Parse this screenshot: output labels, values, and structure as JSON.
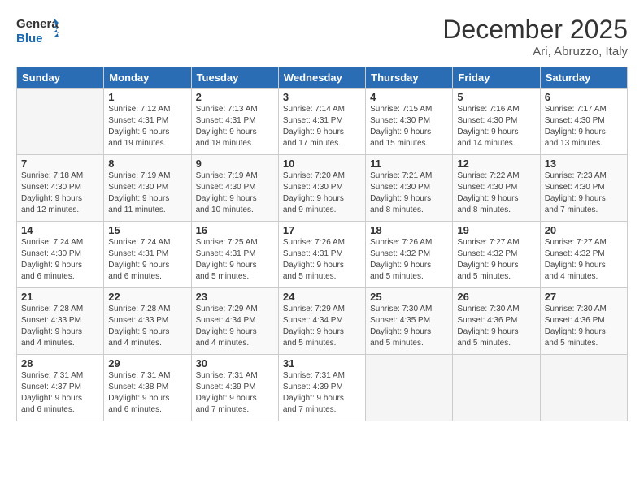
{
  "header": {
    "logo_line1": "General",
    "logo_line2": "Blue",
    "month": "December 2025",
    "location": "Ari, Abruzzo, Italy"
  },
  "weekdays": [
    "Sunday",
    "Monday",
    "Tuesday",
    "Wednesday",
    "Thursday",
    "Friday",
    "Saturday"
  ],
  "weeks": [
    [
      {
        "day": "",
        "info": ""
      },
      {
        "day": "1",
        "info": "Sunrise: 7:12 AM\nSunset: 4:31 PM\nDaylight: 9 hours\nand 19 minutes."
      },
      {
        "day": "2",
        "info": "Sunrise: 7:13 AM\nSunset: 4:31 PM\nDaylight: 9 hours\nand 18 minutes."
      },
      {
        "day": "3",
        "info": "Sunrise: 7:14 AM\nSunset: 4:31 PM\nDaylight: 9 hours\nand 17 minutes."
      },
      {
        "day": "4",
        "info": "Sunrise: 7:15 AM\nSunset: 4:30 PM\nDaylight: 9 hours\nand 15 minutes."
      },
      {
        "day": "5",
        "info": "Sunrise: 7:16 AM\nSunset: 4:30 PM\nDaylight: 9 hours\nand 14 minutes."
      },
      {
        "day": "6",
        "info": "Sunrise: 7:17 AM\nSunset: 4:30 PM\nDaylight: 9 hours\nand 13 minutes."
      }
    ],
    [
      {
        "day": "7",
        "info": "Sunrise: 7:18 AM\nSunset: 4:30 PM\nDaylight: 9 hours\nand 12 minutes."
      },
      {
        "day": "8",
        "info": "Sunrise: 7:19 AM\nSunset: 4:30 PM\nDaylight: 9 hours\nand 11 minutes."
      },
      {
        "day": "9",
        "info": "Sunrise: 7:19 AM\nSunset: 4:30 PM\nDaylight: 9 hours\nand 10 minutes."
      },
      {
        "day": "10",
        "info": "Sunrise: 7:20 AM\nSunset: 4:30 PM\nDaylight: 9 hours\nand 9 minutes."
      },
      {
        "day": "11",
        "info": "Sunrise: 7:21 AM\nSunset: 4:30 PM\nDaylight: 9 hours\nand 8 minutes."
      },
      {
        "day": "12",
        "info": "Sunrise: 7:22 AM\nSunset: 4:30 PM\nDaylight: 9 hours\nand 8 minutes."
      },
      {
        "day": "13",
        "info": "Sunrise: 7:23 AM\nSunset: 4:30 PM\nDaylight: 9 hours\nand 7 minutes."
      }
    ],
    [
      {
        "day": "14",
        "info": "Sunrise: 7:24 AM\nSunset: 4:30 PM\nDaylight: 9 hours\nand 6 minutes."
      },
      {
        "day": "15",
        "info": "Sunrise: 7:24 AM\nSunset: 4:31 PM\nDaylight: 9 hours\nand 6 minutes."
      },
      {
        "day": "16",
        "info": "Sunrise: 7:25 AM\nSunset: 4:31 PM\nDaylight: 9 hours\nand 5 minutes."
      },
      {
        "day": "17",
        "info": "Sunrise: 7:26 AM\nSunset: 4:31 PM\nDaylight: 9 hours\nand 5 minutes."
      },
      {
        "day": "18",
        "info": "Sunrise: 7:26 AM\nSunset: 4:32 PM\nDaylight: 9 hours\nand 5 minutes."
      },
      {
        "day": "19",
        "info": "Sunrise: 7:27 AM\nSunset: 4:32 PM\nDaylight: 9 hours\nand 5 minutes."
      },
      {
        "day": "20",
        "info": "Sunrise: 7:27 AM\nSunset: 4:32 PM\nDaylight: 9 hours\nand 4 minutes."
      }
    ],
    [
      {
        "day": "21",
        "info": "Sunrise: 7:28 AM\nSunset: 4:33 PM\nDaylight: 9 hours\nand 4 minutes."
      },
      {
        "day": "22",
        "info": "Sunrise: 7:28 AM\nSunset: 4:33 PM\nDaylight: 9 hours\nand 4 minutes."
      },
      {
        "day": "23",
        "info": "Sunrise: 7:29 AM\nSunset: 4:34 PM\nDaylight: 9 hours\nand 4 minutes."
      },
      {
        "day": "24",
        "info": "Sunrise: 7:29 AM\nSunset: 4:34 PM\nDaylight: 9 hours\nand 5 minutes."
      },
      {
        "day": "25",
        "info": "Sunrise: 7:30 AM\nSunset: 4:35 PM\nDaylight: 9 hours\nand 5 minutes."
      },
      {
        "day": "26",
        "info": "Sunrise: 7:30 AM\nSunset: 4:36 PM\nDaylight: 9 hours\nand 5 minutes."
      },
      {
        "day": "27",
        "info": "Sunrise: 7:30 AM\nSunset: 4:36 PM\nDaylight: 9 hours\nand 5 minutes."
      }
    ],
    [
      {
        "day": "28",
        "info": "Sunrise: 7:31 AM\nSunset: 4:37 PM\nDaylight: 9 hours\nand 6 minutes."
      },
      {
        "day": "29",
        "info": "Sunrise: 7:31 AM\nSunset: 4:38 PM\nDaylight: 9 hours\nand 6 minutes."
      },
      {
        "day": "30",
        "info": "Sunrise: 7:31 AM\nSunset: 4:39 PM\nDaylight: 9 hours\nand 7 minutes."
      },
      {
        "day": "31",
        "info": "Sunrise: 7:31 AM\nSunset: 4:39 PM\nDaylight: 9 hours\nand 7 minutes."
      },
      {
        "day": "",
        "info": ""
      },
      {
        "day": "",
        "info": ""
      },
      {
        "day": "",
        "info": ""
      }
    ]
  ]
}
